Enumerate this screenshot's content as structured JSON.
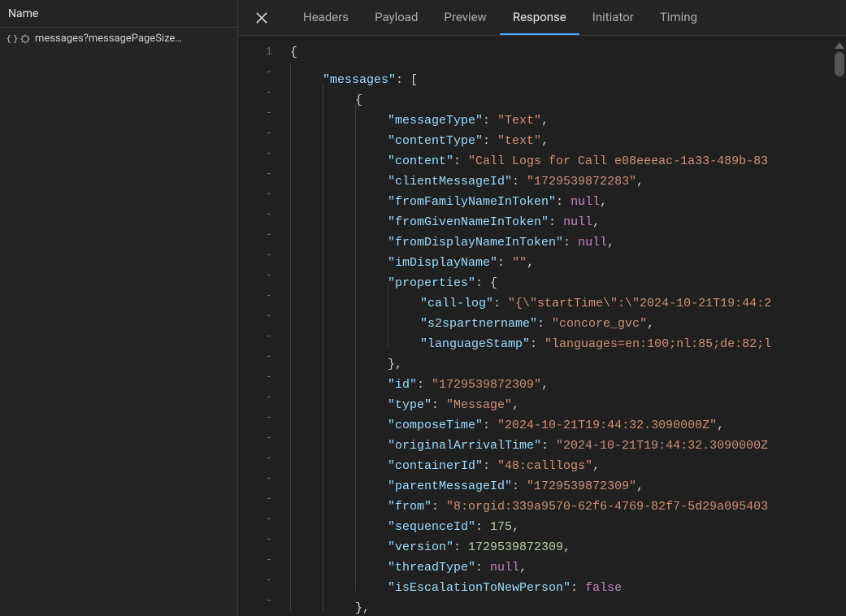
{
  "sidebar": {
    "header": "Name",
    "requests": [
      {
        "icon": "json-icon",
        "name": "messages?messagePageSize…"
      }
    ]
  },
  "tabs": {
    "close_tooltip": "Close",
    "items": [
      {
        "id": "headers",
        "label": "Headers",
        "active": false
      },
      {
        "id": "payload",
        "label": "Payload",
        "active": false
      },
      {
        "id": "preview",
        "label": "Preview",
        "active": false
      },
      {
        "id": "response",
        "label": "Response",
        "active": true
      },
      {
        "id": "initiator",
        "label": "Initiator",
        "active": false
      },
      {
        "id": "timing",
        "label": "Timing",
        "active": false
      }
    ]
  },
  "gutter": {
    "first": "1",
    "dash": "-"
  },
  "response_json": {
    "messages": [
      {
        "messageType": "Text",
        "contentType": "text",
        "content": "Call Logs for Call e08eeeac-1a33-489b-83",
        "clientMessageId": "1729539872283",
        "fromFamilyNameInToken": null,
        "fromGivenNameInToken": null,
        "fromDisplayNameInToken": null,
        "imDisplayName": "",
        "properties": {
          "call-log": "{\\\"startTime\\\":\\\"2024-10-21T19:44:2",
          "s2spartnername": "concore_gvc",
          "languageStamp": "languages=en:100;nl:85;de:82;l"
        },
        "id": "1729539872309",
        "type": "Message",
        "composeTime": "2024-10-21T19:44:32.3090000Z",
        "originalArrivalTime": "2024-10-21T19:44:32.3090000Z",
        "containerId": "48:calllogs",
        "parentMessageId": "1729539872309",
        "from": "8:orgid:339a9570-62f6-4769-82f7-5d29a095403",
        "sequenceId": 175,
        "version": 1729539872309,
        "threadType": null,
        "isEscalationToNewPerson": false
      }
    ]
  },
  "code_lines": [
    {
      "indent": 0,
      "raw": "{"
    },
    {
      "indent": 1,
      "key": "messages",
      "after": "["
    },
    {
      "indent": 2,
      "raw": "{"
    },
    {
      "indent": 3,
      "key": "messageType",
      "str": "Text",
      "comma": true
    },
    {
      "indent": 3,
      "key": "contentType",
      "str": "text",
      "comma": true
    },
    {
      "indent": 3,
      "key": "content",
      "str": "Call Logs for Call e08eeeac-1a33-489b-83",
      "clip": true
    },
    {
      "indent": 3,
      "key": "clientMessageId",
      "str": "1729539872283",
      "comma": true
    },
    {
      "indent": 3,
      "key": "fromFamilyNameInToken",
      "nul": true,
      "comma": true
    },
    {
      "indent": 3,
      "key": "fromGivenNameInToken",
      "nul": true,
      "comma": true
    },
    {
      "indent": 3,
      "key": "fromDisplayNameInToken",
      "nul": true,
      "comma": true
    },
    {
      "indent": 3,
      "key": "imDisplayName",
      "str": "",
      "comma": true
    },
    {
      "indent": 3,
      "key": "properties",
      "after": "{"
    },
    {
      "indent": 4,
      "key": "call-log",
      "str": "{\\\"startTime\\\":\\\"2024-10-21T19:44:2",
      "clip": true
    },
    {
      "indent": 4,
      "key": "s2spartnername",
      "str": "concore_gvc",
      "comma": true
    },
    {
      "indent": 4,
      "key": "languageStamp",
      "str": "languages=en:100;nl:85;de:82;l",
      "clip": true
    },
    {
      "indent": 3,
      "raw": "},",
      "close": true
    },
    {
      "indent": 3,
      "key": "id",
      "str": "1729539872309",
      "comma": true
    },
    {
      "indent": 3,
      "key": "type",
      "str": "Message",
      "comma": true
    },
    {
      "indent": 3,
      "key": "composeTime",
      "str": "2024-10-21T19:44:32.3090000Z",
      "comma": true
    },
    {
      "indent": 3,
      "key": "originalArrivalTime",
      "str": "2024-10-21T19:44:32.3090000Z",
      "clip": true
    },
    {
      "indent": 3,
      "key": "containerId",
      "str": "48:calllogs",
      "comma": true
    },
    {
      "indent": 3,
      "key": "parentMessageId",
      "str": "1729539872309",
      "comma": true
    },
    {
      "indent": 3,
      "key": "from",
      "str": "8:orgid:339a9570-62f6-4769-82f7-5d29a095403",
      "clip": true
    },
    {
      "indent": 3,
      "key": "sequenceId",
      "num": 175,
      "comma": true
    },
    {
      "indent": 3,
      "key": "version",
      "num": 1729539872309,
      "comma": true
    },
    {
      "indent": 3,
      "key": "threadType",
      "nul": true,
      "comma": true
    },
    {
      "indent": 3,
      "key": "isEscalationToNewPerson",
      "bool": false
    },
    {
      "indent": 2,
      "raw": "},",
      "close": true
    }
  ]
}
